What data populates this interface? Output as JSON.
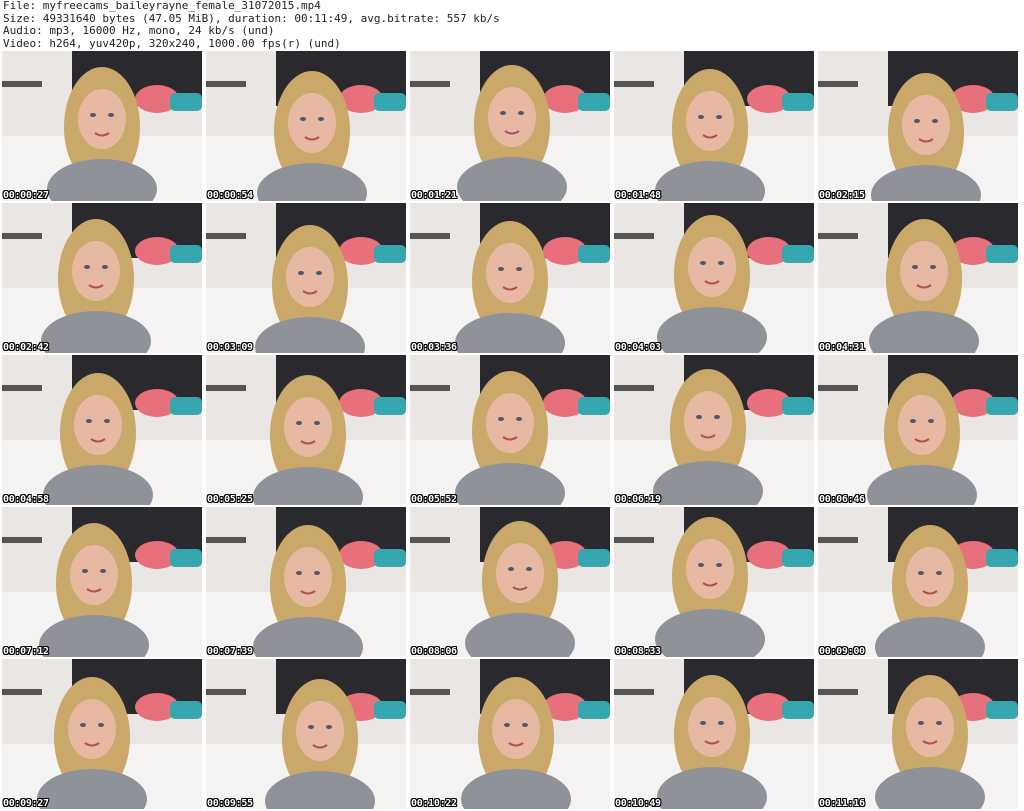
{
  "header": {
    "file_line": "File: myfreecams_baileyrayne_female_31072015.mp4",
    "size_line": "Size: 49331640 bytes (47.05 MiB), duration: 00:11:49, avg.bitrate: 557 kb/s",
    "audio_line": "Audio: mp3, 16000 Hz, mono, 24 kb/s (und)",
    "video_line": "Video: h264, yuv420p, 320x240, 1000.00 fps(r) (und)"
  },
  "thumbnails": [
    {
      "timestamp": "00:00:27",
      "icon": "video-frame"
    },
    {
      "timestamp": "00:00:54",
      "icon": "video-frame"
    },
    {
      "timestamp": "00:01:21",
      "icon": "video-frame"
    },
    {
      "timestamp": "00:01:48",
      "icon": "video-frame"
    },
    {
      "timestamp": "00:02:15",
      "icon": "video-frame"
    },
    {
      "timestamp": "00:02:42",
      "icon": "video-frame"
    },
    {
      "timestamp": "00:03:09",
      "icon": "video-frame"
    },
    {
      "timestamp": "00:03:36",
      "icon": "video-frame"
    },
    {
      "timestamp": "00:04:03",
      "icon": "video-frame"
    },
    {
      "timestamp": "00:04:31",
      "icon": "video-frame"
    },
    {
      "timestamp": "00:04:58",
      "icon": "video-frame"
    },
    {
      "timestamp": "00:05:25",
      "icon": "video-frame"
    },
    {
      "timestamp": "00:05:52",
      "icon": "video-frame"
    },
    {
      "timestamp": "00:06:19",
      "icon": "video-frame"
    },
    {
      "timestamp": "00:06:46",
      "icon": "video-frame"
    },
    {
      "timestamp": "00:07:12",
      "icon": "video-frame"
    },
    {
      "timestamp": "00:07:39",
      "icon": "video-frame"
    },
    {
      "timestamp": "00:08:06",
      "icon": "video-frame"
    },
    {
      "timestamp": "00:08:33",
      "icon": "video-frame"
    },
    {
      "timestamp": "00:09:00",
      "icon": "video-frame"
    },
    {
      "timestamp": "00:09:27",
      "icon": "video-frame"
    },
    {
      "timestamp": "00:09:55",
      "icon": "video-frame"
    },
    {
      "timestamp": "00:10:22",
      "icon": "video-frame"
    },
    {
      "timestamp": "00:10:49",
      "icon": "video-frame"
    },
    {
      "timestamp": "00:11:16",
      "icon": "video-frame"
    }
  ],
  "colors": {
    "background": "#ffffff",
    "wall": "#e9e6e4",
    "headboard": "#2a2a2e",
    "pillow_teal": "#35a6ae",
    "pillow_pink": "#e8707c",
    "bedding": "#f4f3f1",
    "hair": "#c9a86a",
    "skin": "#e7b9a3",
    "shirt": "#8f9399"
  }
}
